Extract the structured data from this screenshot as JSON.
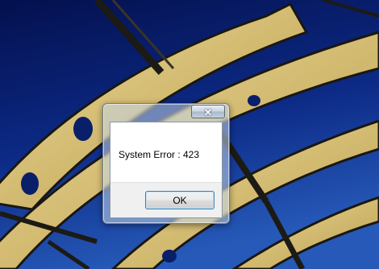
{
  "dialog": {
    "close_glyph": "✕",
    "message": "System Error : 423",
    "ok_label": "OK"
  },
  "colors": {
    "sky_top": "#06155a",
    "sky_bottom": "#1f4fb0",
    "arch": "#d8c07a",
    "arch_shadow": "#1c1a14"
  },
  "icons": [
    "close-icon"
  ]
}
